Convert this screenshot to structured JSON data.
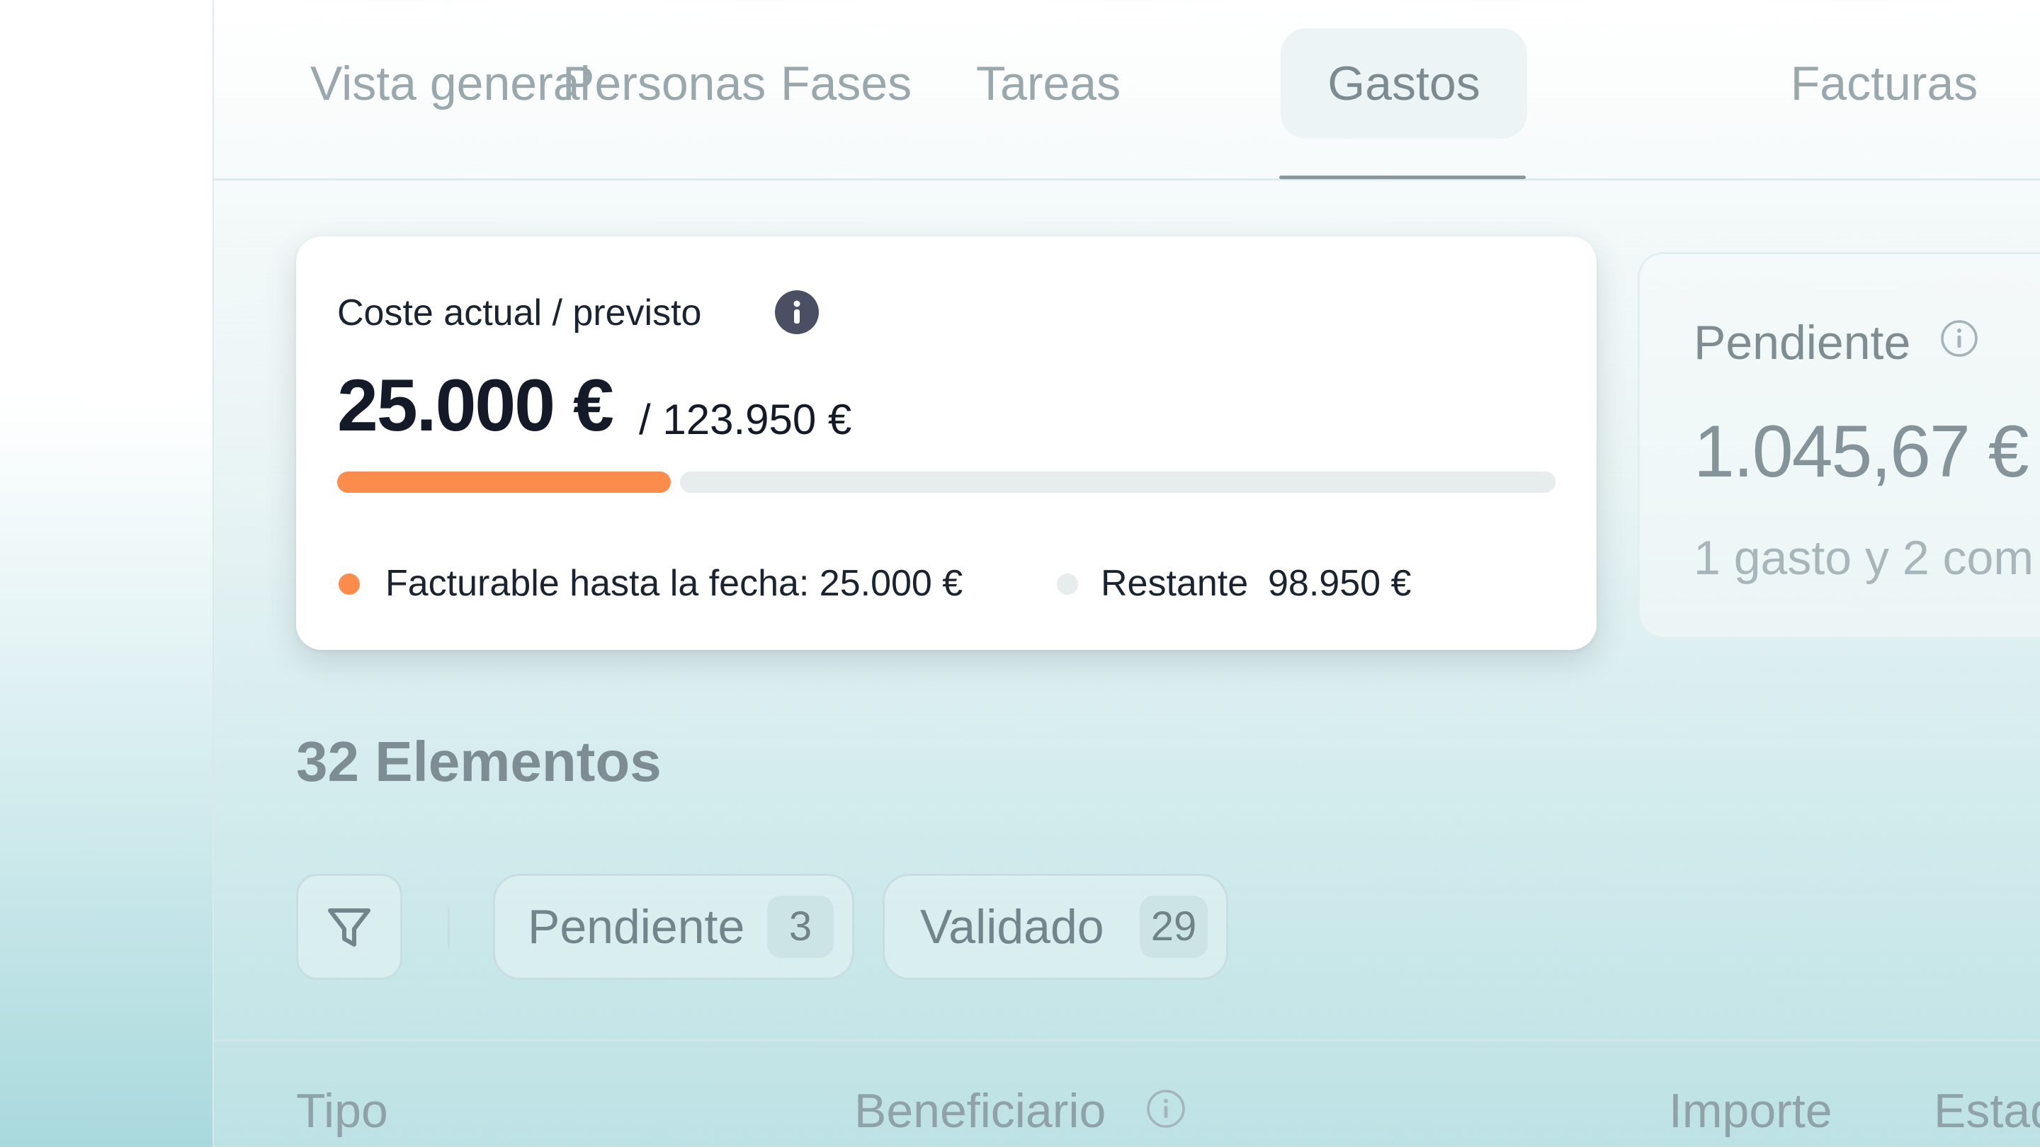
{
  "tabs": [
    {
      "label": "Vista general",
      "active": false
    },
    {
      "label": "Personas",
      "active": false
    },
    {
      "label": "Fases",
      "active": false
    },
    {
      "label": "Tareas",
      "active": false
    },
    {
      "label": "Gastos",
      "active": true
    },
    {
      "label": "Facturas",
      "active": false
    }
  ],
  "cost_card": {
    "title": "Coste actual / previsto",
    "info_icon": "info-icon",
    "current": "25.000 €",
    "planned": "/ 123.950 €",
    "progress_fraction": 0.2,
    "legend_billable": "Facturable hasta la fecha: 25.000 €",
    "legend_remaining_label": "Restante",
    "legend_remaining_value": "98.950 €",
    "colors": {
      "billable": "#fb8c4c",
      "remaining": "#e7eced"
    }
  },
  "pending_card": {
    "title": "Pendiente",
    "info_icon": "info-outline-icon",
    "amount": "1.045,67 €",
    "subtitle": "1 gasto y 2 com"
  },
  "items_heading": "32 Elementos",
  "filters": {
    "filter_icon": "filter-icon",
    "chips": [
      {
        "label": "Pendiente",
        "count": "3"
      },
      {
        "label": "Validado",
        "count": "29"
      }
    ]
  },
  "table": {
    "columns": [
      "Tipo",
      "Beneficiario",
      "Importe",
      "Estado"
    ]
  }
}
